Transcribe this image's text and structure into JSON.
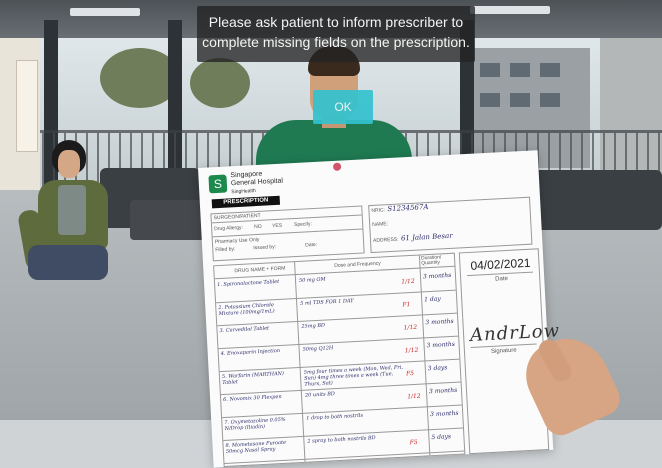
{
  "dialog": {
    "message_line1": "Please ask patient to inform prescriber to",
    "message_line2": "complete missing fields on the prescription.",
    "ok_label": "OK"
  },
  "prescription": {
    "hospital_line1": "Singapore",
    "hospital_line2": "General Hospital",
    "hospital_line3": "SingHealth",
    "title": "PRESCRIPTION",
    "sticker_label": "SURGEON/PATIENT",
    "drug_allergy_label": "Drug Allergy:",
    "allergy_no": "NO",
    "allergy_yes": "YES",
    "specify_label": "Specify:",
    "pharmacy_use_label": "Pharmacy Use Only",
    "filled_by_label": "Filled by:",
    "issued_by_label": "Issued by:",
    "date_label_small": "Date:",
    "nric_label": "NRIC:",
    "nric_value": "S1234567A",
    "name_label": "NAME:",
    "name_value": "",
    "address_label": "ADDRESS:",
    "address_value": "61 Jalan Besar",
    "col_drug": "DRUG NAME + FORM",
    "col_dose": "Dose and Frequency",
    "col_duration": "Duration/ Quantity",
    "date_value": "04/02/2021",
    "date_caption": "Date",
    "signature_value": "AndrLow",
    "signature_caption": "Signature",
    "items": [
      {
        "drug": "1. Spironolactone Tablet",
        "dose": "50 mg OM",
        "flag": "1/12",
        "duration": "3 months"
      },
      {
        "drug": "2. Potassium Chloride Mixture (100mg/1mL)",
        "dose": "5 ml TDS FOR 1 DAY",
        "flag": "F1",
        "duration": "1 day"
      },
      {
        "drug": "3. Carvedilol Tablet",
        "dose": "25mg BD",
        "flag": "1/12",
        "duration": "3 months"
      },
      {
        "drug": "4. Enoxaparin Injection",
        "dose": "50mg Q12H",
        "flag": "1/12",
        "duration": "3 months"
      },
      {
        "drug": "5. Warfarin (MARTHAN) Tablet",
        "dose": "5mg four times a week (Mon, Wed, Fri, Sun) 4mg three times a week (Tue, Thurs, Sat)",
        "flag": "F5",
        "duration": "3 days"
      },
      {
        "drug": "6. Novomix 30 Flexpen",
        "dose": "20 units BD",
        "flag": "1/12",
        "duration": "3 months"
      },
      {
        "drug": "7. Oxymetazoline 0.05% N/Drop (Iliadin)",
        "dose": "1 drop to both nostrils",
        "flag": "",
        "duration": "3 months"
      },
      {
        "drug": "8. Mometasone Furoate 50mcg Nasal Spray",
        "dose": "2 spray to both nostrils BD",
        "flag": "F5",
        "duration": "5 days"
      }
    ]
  }
}
